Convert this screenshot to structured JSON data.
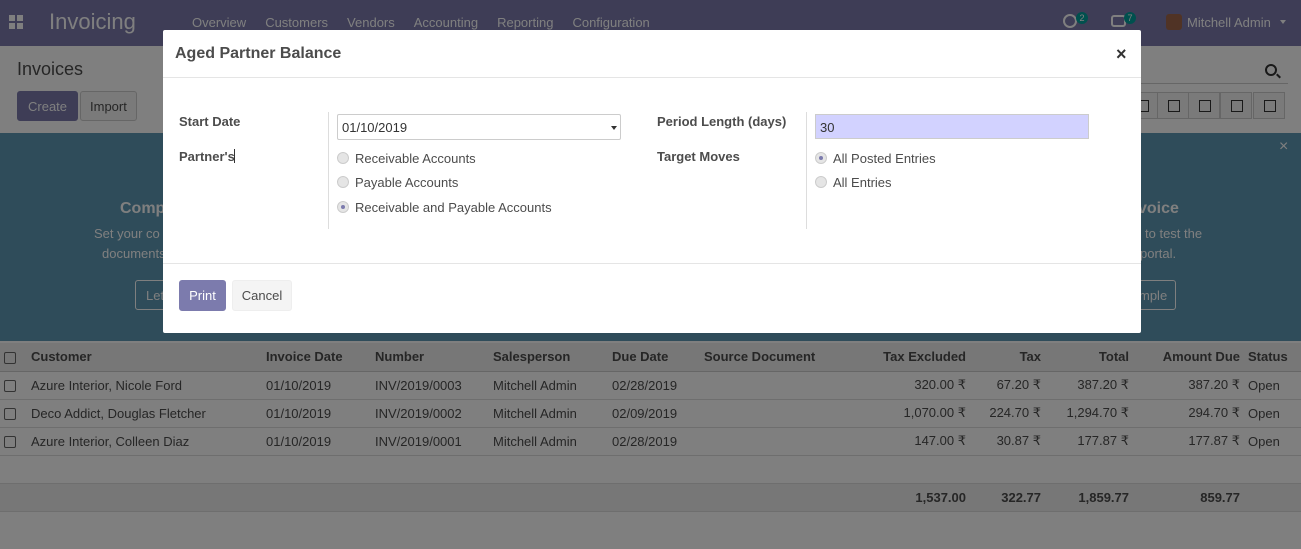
{
  "navbar": {
    "app_title": "Invoicing",
    "menu": [
      "Overview",
      "Customers",
      "Vendors",
      "Accounting",
      "Reporting",
      "Configuration"
    ],
    "activity_count": "2",
    "message_count": "7",
    "user_name": "Mitchell Admin"
  },
  "control_panel": {
    "breadcrumb": "Invoices",
    "create_label": "Create",
    "import_label": "Import"
  },
  "banner": {
    "left_title": "Comp",
    "left_text_1": "Set your co",
    "left_text_2": "documents",
    "left_button": "Let",
    "right_title": "voice",
    "right_text_1": "to test the",
    "right_text_2": "portal.",
    "right_button": "mple"
  },
  "table": {
    "columns": [
      "Customer",
      "Invoice Date",
      "Number",
      "Salesperson",
      "Due Date",
      "Source Document",
      "Tax Excluded",
      "Tax",
      "Total",
      "Amount Due",
      "Status"
    ],
    "rows": [
      [
        "Azure Interior, Nicole Ford",
        "01/10/2019",
        "INV/2019/0003",
        "Mitchell Admin",
        "02/28/2019",
        "",
        "320.00 ₹",
        "67.20 ₹",
        "387.20 ₹",
        "387.20 ₹",
        "Open"
      ],
      [
        "Deco Addict, Douglas Fletcher",
        "01/10/2019",
        "INV/2019/0002",
        "Mitchell Admin",
        "02/09/2019",
        "",
        "1,070.00 ₹",
        "224.70 ₹",
        "1,294.70 ₹",
        "294.70 ₹",
        "Open"
      ],
      [
        "Azure Interior, Colleen Diaz",
        "01/10/2019",
        "INV/2019/0001",
        "Mitchell Admin",
        "02/28/2019",
        "",
        "147.00 ₹",
        "30.87 ₹",
        "177.87 ₹",
        "177.87 ₹",
        "Open"
      ]
    ],
    "totals": [
      "1,537.00",
      "322.77",
      "1,859.77",
      "859.77"
    ]
  },
  "dialog": {
    "title": "Aged Partner Balance",
    "close": "×",
    "start_date_label": "Start Date",
    "start_date_value": "01/10/2019",
    "partners_label": "Partner's",
    "partner_options": [
      "Receivable Accounts",
      "Payable Accounts",
      "Receivable and Payable Accounts"
    ],
    "partner_selected": 2,
    "period_label": "Period Length (days)",
    "period_value": "30",
    "target_label": "Target Moves",
    "target_options": [
      "All Posted Entries",
      "All Entries"
    ],
    "target_selected": 0,
    "print_label": "Print",
    "cancel_label": "Cancel"
  },
  "colors": {
    "brand": "#7c7bad",
    "banner": "#5e98b4",
    "badge": "#00a09d",
    "period_input_bg": "#d2d2ff"
  }
}
